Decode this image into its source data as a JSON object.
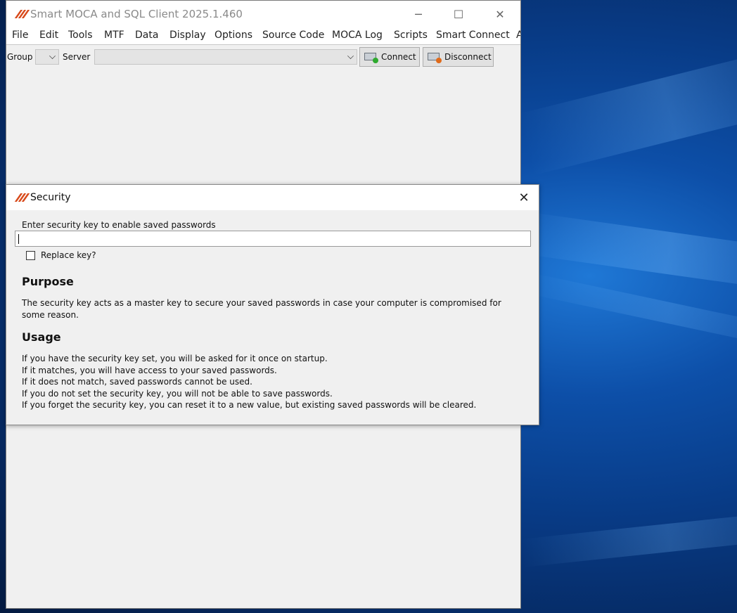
{
  "app": {
    "title": "Smart MOCA and SQL Client 2025.1.460",
    "window_controls": {
      "minimize": "─",
      "maximize": "☐",
      "close": "✕"
    }
  },
  "menu": [
    "File",
    "Edit",
    "Tools",
    "MTF",
    "Data",
    "Display",
    "Options",
    "Source Code",
    "MOCA Log",
    "Scripts",
    "Smart Connect",
    "A"
  ],
  "toolbar": {
    "group_label": "Group",
    "group_value": "",
    "server_label": "Server",
    "server_value": "",
    "connect_label": "Connect",
    "disconnect_label": "Disconnect"
  },
  "dialog": {
    "title": "Security",
    "close_glyph": "✕",
    "prompt": "Enter security key to enable saved passwords",
    "key_value": "",
    "replace_label": "Replace key?",
    "replace_checked": false,
    "purpose_heading": "Purpose",
    "purpose_text": "The security key acts as a master key to secure your saved passwords in case your computer is compromised for some reason.",
    "usage_heading": "Usage",
    "usage_lines": [
      "If you have the security key set, you will be asked for it once on startup.",
      "If it matches, you will have access to your saved passwords.",
      "If it does not match, saved passwords cannot be used.",
      "If you do not set the security key, you will not be able to save passwords.",
      "If you forget the security key, you can reset it to a new value, but existing saved passwords will be cleared."
    ]
  },
  "colors": {
    "brand": "#d84a1b",
    "connect_status": "#2eaa2e",
    "disconnect_status": "#e06a1a"
  }
}
